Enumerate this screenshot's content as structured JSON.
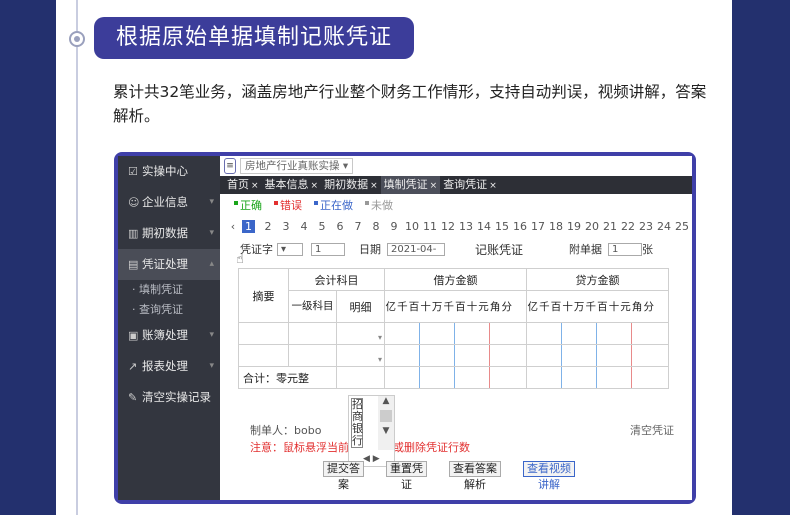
{
  "heading": "根据原始单据填制记账凭证",
  "description": "累计共32笔业务，涵盖房地产行业整个财务工作情形，支持自动判误，视频讲解，答案解析。",
  "sidebar": {
    "items": [
      {
        "label": "实操中心",
        "icon": "checkbox-icon"
      },
      {
        "label": "企业信息",
        "icon": "people-icon"
      },
      {
        "label": "期初数据",
        "icon": "bar-chart-icon"
      },
      {
        "label": "凭证处理",
        "icon": "document-icon"
      },
      {
        "label": "账簿处理",
        "icon": "book-icon"
      },
      {
        "label": "报表处理",
        "icon": "line-chart-icon"
      },
      {
        "label": "清空实操记录",
        "icon": "brush-icon"
      }
    ],
    "subitems": [
      "填制凭证",
      "查询凭证"
    ]
  },
  "toolbar": {
    "industry_select": "房地产行业真账实操"
  },
  "tabs": [
    "首页",
    "基本信息",
    "期初数据",
    "填制凭证",
    "查询凭证"
  ],
  "legend": [
    {
      "label": "正确",
      "color": "#1aa51a"
    },
    {
      "label": "错误",
      "color": "#e23030"
    },
    {
      "label": "正在做",
      "color": "#3b66c9"
    },
    {
      "label": "未做",
      "color": "#999999"
    }
  ],
  "pages": [
    "1",
    "2",
    "3",
    "4",
    "5",
    "6",
    "7",
    "8",
    "9",
    "10",
    "11",
    "12",
    "13",
    "14",
    "15",
    "16",
    "17",
    "18",
    "19",
    "20",
    "21",
    "22",
    "23",
    "24",
    "25"
  ],
  "voucher": {
    "type_label": "凭证字",
    "number": "1",
    "date_label": "日期",
    "date_value": "2021-04-",
    "title": "记账凭证",
    "attach_label": "附单据",
    "attach_value": "1",
    "attach_unit": "张",
    "col_summary": "摘要",
    "col_account": "会计科目",
    "col_level1": "一级科目",
    "col_detail": "明细",
    "col_debit": "借方金额",
    "col_credit": "贷方金额",
    "digits": [
      "亿",
      "千",
      "百",
      "十",
      "万",
      "千",
      "百",
      "十",
      "元",
      "角",
      "分"
    ],
    "total": "合计：零元整",
    "maker": "制单人：bobo",
    "clear": "清空凭证",
    "note": "注意：鼠标悬浮当前行以增加或删除凭证行数",
    "popup_text": "招商银行"
  },
  "buttons": [
    {
      "face": "提交答",
      "sub": "案"
    },
    {
      "face": "重置凭",
      "sub": "证"
    },
    {
      "face": "查看答案",
      "sub": "解析"
    },
    {
      "face": "查看视频",
      "sub": "讲解"
    }
  ]
}
